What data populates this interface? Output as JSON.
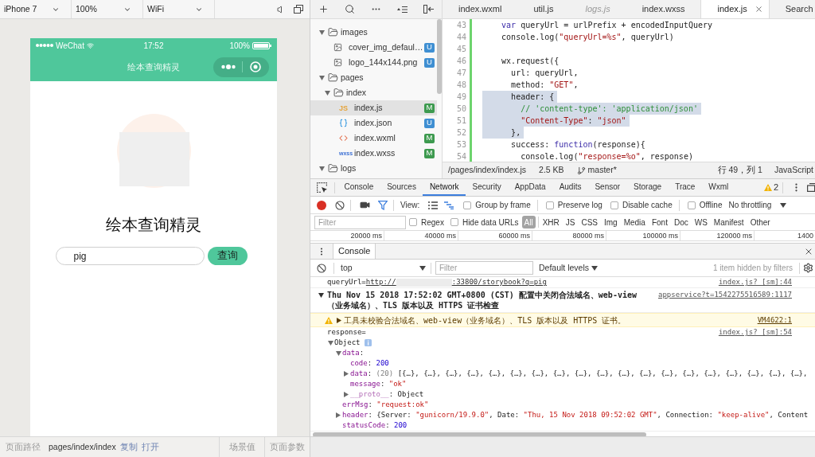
{
  "simulator": {
    "toolbar": {
      "dropdowns": [
        "iPhone 7",
        "100%",
        "WiFi"
      ]
    },
    "phone": {
      "status_bar": {
        "carrier": "WeChat",
        "time": "17:52",
        "battery": "100%"
      },
      "nav_bar": {
        "title": "绘本查询精灵"
      },
      "heading": "绘本查询精灵",
      "search": {
        "value": "pig"
      },
      "search_button": "查询"
    },
    "bottom_bar": {
      "path_label": "页面路径",
      "path": "pages/index/index",
      "actions": [
        "复制",
        "打开"
      ],
      "scene": "场景值",
      "params": "页面参数"
    }
  },
  "explorer": {
    "tree": [
      {
        "name": "images",
        "kind": "folder",
        "expanded": true,
        "selected": false,
        "children": [
          {
            "name": "cover_img_defaul…",
            "kind": "image",
            "selected": false,
            "badge": {
              "text": "U",
              "color": "#3f8fd2"
            }
          },
          {
            "name": "logo_144x144.png",
            "kind": "image",
            "selected": false,
            "badge": {
              "text": "U",
              "color": "#3f8fd2"
            }
          }
        ]
      },
      {
        "name": "pages",
        "kind": "folder",
        "expanded": true,
        "selected": false,
        "children": [
          {
            "name": "index",
            "kind": "folder",
            "expanded": true,
            "selected": false,
            "children": [
              {
                "name": "index.js",
                "kind": "js",
                "icon_text": "JS",
                "selected": true,
                "badge": {
                  "text": "M",
                  "color": "#3d9a4f"
                }
              },
              {
                "name": "index.json",
                "kind": "json",
                "selected": false,
                "badge": {
                  "text": "U",
                  "color": "#3f8fd2"
                }
              },
              {
                "name": "index.wxml",
                "kind": "wxml",
                "selected": false,
                "badge": {
                  "text": "M",
                  "color": "#3d9a4f"
                }
              },
              {
                "name": "index.wxss",
                "kind": "wxss",
                "icon_text": "wxss",
                "selected": false,
                "badge": {
                  "text": "M",
                  "color": "#3d9a4f"
                }
              }
            ]
          }
        ]
      },
      {
        "name": "logs",
        "kind": "folder",
        "expanded": true,
        "selected": false
      }
    ]
  },
  "editor": {
    "tabs": [
      {
        "label": "index.wxml",
        "selected": false,
        "preview": false
      },
      {
        "label": "util.js",
        "selected": false,
        "preview": false
      },
      {
        "label": "logs.js",
        "selected": false,
        "preview": true
      },
      {
        "label": "index.wxss",
        "selected": false,
        "preview": false
      },
      {
        "label": "index.js",
        "selected": true,
        "preview": false
      },
      {
        "label": "Search",
        "selected": false,
        "preview": false
      }
    ],
    "modified": true,
    "lines": [
      {
        "number": "43",
        "highlighted": false,
        "tokens": [
          {
            "text": "    var",
            "kind": "keyword"
          },
          {
            "text": " queryUrl = urlPrefix + encodedInputQuery",
            "kind": "plain"
          }
        ]
      },
      {
        "number": "44",
        "highlighted": false,
        "tokens": [
          {
            "text": "    console.log(",
            "kind": "plain"
          },
          {
            "text": "\"queryUrl=%s\"",
            "kind": "string"
          },
          {
            "text": ", queryUrl)",
            "kind": "plain"
          }
        ]
      },
      {
        "number": "45",
        "highlighted": false
      },
      {
        "number": "46",
        "highlighted": false,
        "tokens": [
          {
            "text": "    wx.request({",
            "kind": "plain"
          }
        ]
      },
      {
        "number": "47",
        "highlighted": false,
        "tokens": [
          {
            "text": "      url: queryUrl,",
            "kind": "plain"
          }
        ]
      },
      {
        "number": "48",
        "highlighted": false,
        "tokens": [
          {
            "text": "      method: ",
            "kind": "plain"
          },
          {
            "text": "\"GET\"",
            "kind": "string"
          },
          {
            "text": ",",
            "kind": "plain"
          }
        ]
      },
      {
        "number": "49",
        "highlighted": true,
        "tokens": [
          {
            "text": "      header: {",
            "kind": "plain"
          }
        ]
      },
      {
        "number": "50",
        "highlighted": true,
        "tokens": [
          {
            "text": "        // 'content-type': 'application/json'",
            "kind": "comment"
          }
        ]
      },
      {
        "number": "51",
        "highlighted": true,
        "tokens": [
          {
            "text": "        \"Content-Type\"",
            "kind": "string"
          },
          {
            "text": ": ",
            "kind": "plain"
          },
          {
            "text": "\"json\"",
            "kind": "string"
          }
        ]
      },
      {
        "number": "52",
        "highlighted": true,
        "tokens": [
          {
            "text": "      },",
            "kind": "plain"
          }
        ]
      },
      {
        "number": "53",
        "highlighted": false,
        "tokens": [
          {
            "text": "      success: ",
            "kind": "plain"
          },
          {
            "text": "function",
            "kind": "keyword"
          },
          {
            "text": "(response){",
            "kind": "plain"
          }
        ]
      },
      {
        "number": "54",
        "highlighted": false,
        "tokens": [
          {
            "text": "        console.log(",
            "kind": "plain"
          },
          {
            "text": "\"response=%o\"",
            "kind": "string"
          },
          {
            "text": ", response)",
            "kind": "plain"
          }
        ]
      }
    ],
    "status": {
      "path": "/pages/index/index.js",
      "size": "2.5 KB",
      "branch": "master*",
      "position": "行 49，列 1",
      "language": "JavaScript"
    }
  },
  "devtools": {
    "tabs": [
      {
        "label": "Console",
        "selected": false
      },
      {
        "label": "Sources",
        "selected": false
      },
      {
        "label": "Network",
        "selected": true
      },
      {
        "label": "Security",
        "selected": false
      },
      {
        "label": "AppData",
        "selected": false
      },
      {
        "label": "Audits",
        "selected": false
      },
      {
        "label": "Sensor",
        "selected": false
      },
      {
        "label": "Storage",
        "selected": false
      },
      {
        "label": "Trace",
        "selected": false
      },
      {
        "label": "Wxml",
        "selected": false
      }
    ],
    "warning_count": "2",
    "network": {
      "recording": true,
      "filter_active": true,
      "view_label": "View:",
      "view_modes": [
        {
          "kind": "list",
          "selected": false
        },
        {
          "kind": "waterfall",
          "selected": true
        }
      ],
      "options": [
        {
          "label": "Group by frame",
          "checked": false
        },
        {
          "label": "Preserve log",
          "checked": false
        },
        {
          "label": "Disable cache",
          "checked": false
        },
        {
          "label": "Offline",
          "checked": false
        }
      ],
      "throttling": "No throttling",
      "filter": {
        "placeholder": "Filter"
      },
      "filter_options": [
        {
          "label": "Regex",
          "checked": false
        },
        {
          "label": "Hide data URLs",
          "checked": false
        }
      ],
      "types": [
        {
          "label": "All",
          "selected": true
        },
        {
          "label": "XHR",
          "selected": false
        },
        {
          "label": "JS",
          "selected": false
        },
        {
          "label": "CSS",
          "selected": false
        },
        {
          "label": "Img",
          "selected": false
        },
        {
          "label": "Media",
          "selected": false
        },
        {
          "label": "Font",
          "selected": false
        },
        {
          "label": "Doc",
          "selected": false
        },
        {
          "label": "WS",
          "selected": false
        },
        {
          "label": "Manifest",
          "selected": false
        },
        {
          "label": "Other",
          "selected": false
        }
      ],
      "timeline_ticks": [
        "20000 ms",
        "40000 ms",
        "60000 ms",
        "80000 ms",
        "100000 ms",
        "120000 ms",
        "1400"
      ]
    },
    "drawer": {
      "tabs": [
        {
          "label": "Console",
          "selected": true
        }
      ],
      "context": "top",
      "filter": {
        "placeholder": "Filter"
      },
      "levels": "Default levels",
      "hidden_note": "1 item hidden by filters",
      "messages": [
        {
          "kind": "log",
          "text": "queryUrl=",
          "link": {
            "start": "http://",
            "redacted": true,
            "end": ":33800/storybook?q=pig"
          },
          "source": "index.js? [sm]:44"
        },
        {
          "kind": "group",
          "expanded": true,
          "text": "Thu Nov 15 2018 17:52:02 GMT+0800 (CST) 配置中关闭合法域名、web-view（业务域名）、TLS 版本以及 HTTPS 证书检查",
          "source": "appservice?t=1542275516589:1117"
        },
        {
          "kind": "warning",
          "expanded": false,
          "text": "工具未校验合法域名、web-view（业务域名）、TLS 版本以及 HTTPS 证书。",
          "source": "VM4622:1"
        },
        {
          "kind": "log",
          "text": "response=",
          "source": "index.js? [sm]:54",
          "tree": [
            {
              "kind": "branch",
              "expanded": true,
              "info": true,
              "tokens": [
                {
                  "text": "Object",
                  "kind": "plain"
                }
              ],
              "children": [
                {
                  "kind": "branch",
                  "expanded": true,
                  "tokens": [
                    {
                      "text": "data",
                      "kind": "key"
                    },
                    {
                      "text": ":",
                      "kind": "plain"
                    }
                  ],
                  "children": [
                    {
                      "kind": "leaf",
                      "tokens": [
                        {
                          "text": "code",
                          "kind": "key"
                        },
                        {
                          "text": ": ",
                          "kind": "plain"
                        },
                        {
                          "text": "200",
                          "kind": "number"
                        }
                      ]
                    },
                    {
                      "kind": "branch",
                      "expanded": false,
                      "tokens": [
                        {
                          "text": "data",
                          "kind": "key"
                        },
                        {
                          "text": ": ",
                          "kind": "plain"
                        },
                        {
                          "text": "(20)",
                          "kind": "count"
                        },
                        {
                          "text": " [{…}, {…}, {…}, {…}, {…}, {…}, {…}, {…}, {…}, {…}, {…}, {…}, {…}, {…}, {…}, {…}, {…}, {…}, {…},",
                          "kind": "plain"
                        }
                      ]
                    },
                    {
                      "kind": "leaf",
                      "tokens": [
                        {
                          "text": "message",
                          "kind": "key"
                        },
                        {
                          "text": ": ",
                          "kind": "plain"
                        },
                        {
                          "text": "\"ok\"",
                          "kind": "string"
                        }
                      ]
                    },
                    {
                      "kind": "branch",
                      "expanded": false,
                      "tokens": [
                        {
                          "text": "__proto__",
                          "kind": "dimkey"
                        },
                        {
                          "text": ": Object",
                          "kind": "plain"
                        }
                      ]
                    }
                  ]
                },
                {
                  "kind": "leaf",
                  "tokens": [
                    {
                      "text": "errMsg",
                      "kind": "key"
                    },
                    {
                      "text": ": ",
                      "kind": "plain"
                    },
                    {
                      "text": "\"request:ok\"",
                      "kind": "string"
                    }
                  ]
                },
                {
                  "kind": "branch",
                  "expanded": false,
                  "tokens": [
                    {
                      "text": "header",
                      "kind": "key"
                    },
                    {
                      "text": ": {Server: ",
                      "kind": "plain"
                    },
                    {
                      "text": "\"gunicorn/19.9.0\"",
                      "kind": "string"
                    },
                    {
                      "text": ", Date: ",
                      "kind": "plain"
                    },
                    {
                      "text": "\"Thu, 15 Nov 2018 09:52:02 GMT\"",
                      "kind": "string"
                    },
                    {
                      "text": ", Connection: ",
                      "kind": "plain"
                    },
                    {
                      "text": "\"keep-alive\"",
                      "kind": "string"
                    },
                    {
                      "text": ", Content",
                      "kind": "plain"
                    }
                  ]
                },
                {
                  "kind": "leaf",
                  "tokens": [
                    {
                      "text": "statusCode",
                      "kind": "key"
                    },
                    {
                      "text": ": ",
                      "kind": "plain"
                    },
                    {
                      "text": "200",
                      "kind": "number"
                    }
                  ]
                }
              ]
            }
          ]
        }
      ]
    }
  }
}
